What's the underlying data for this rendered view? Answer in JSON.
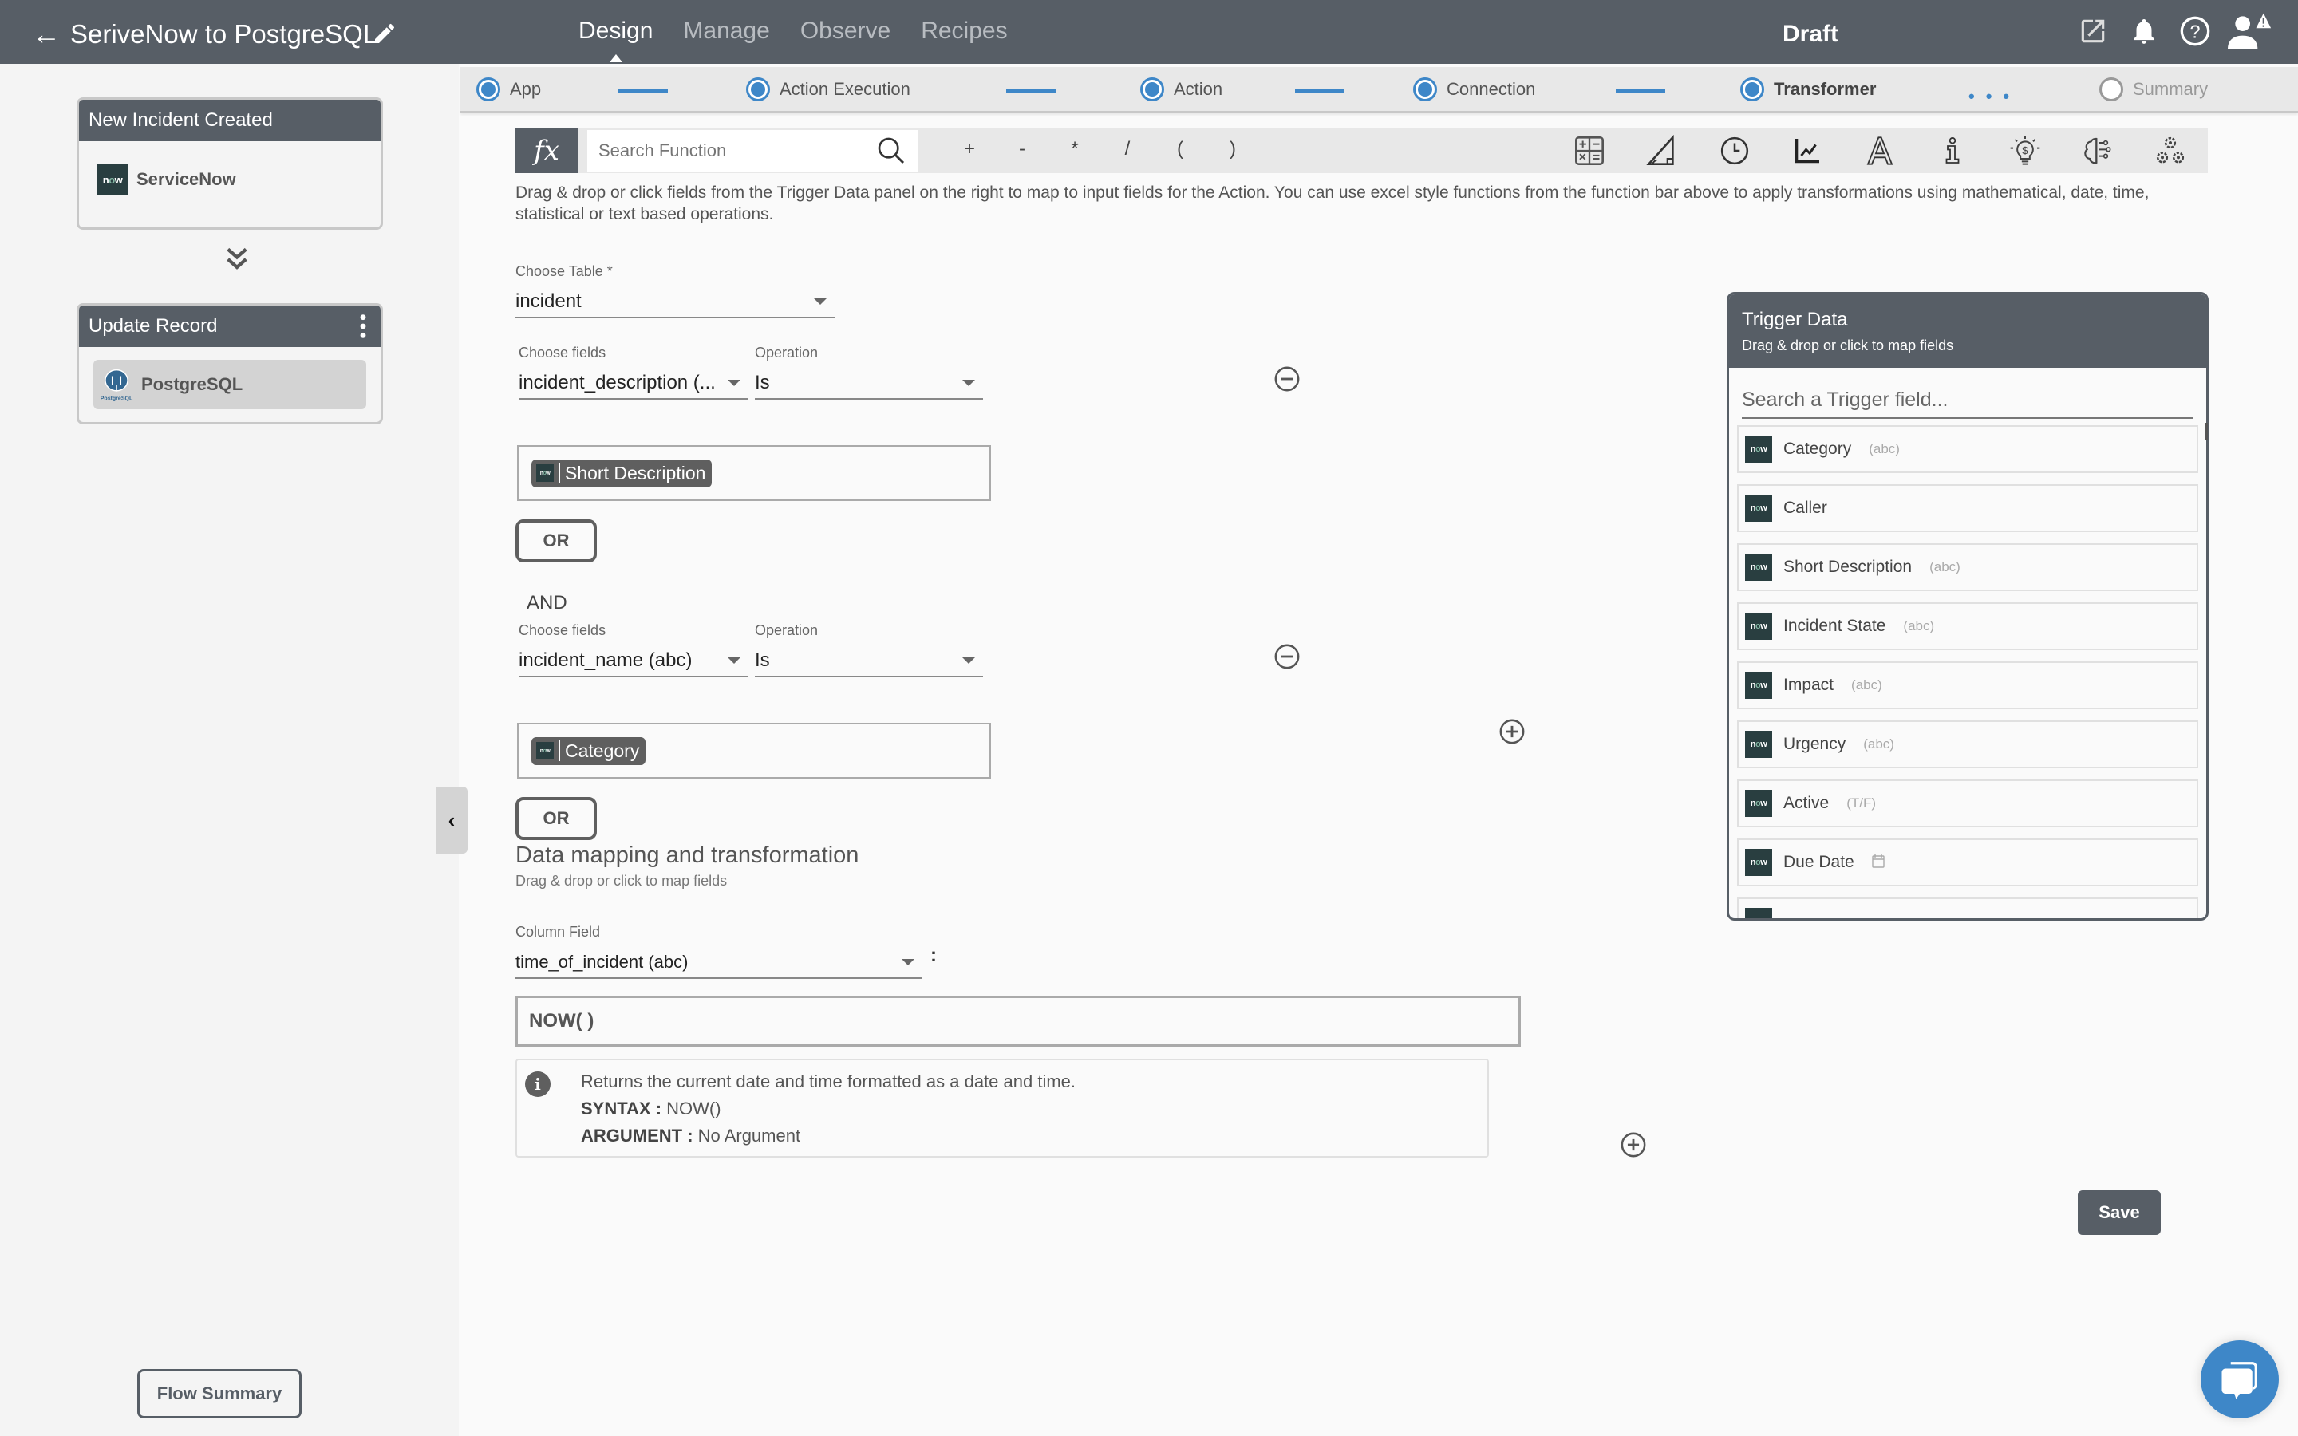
{
  "topbar": {
    "back_icon": "arrow-left-icon",
    "title": "SeriveNow to PostgreSQL",
    "edit_icon": "pencil-icon",
    "tabs": [
      {
        "label": "Design",
        "active": true
      },
      {
        "label": "Manage",
        "active": false
      },
      {
        "label": "Observe",
        "active": false
      },
      {
        "label": "Recipes",
        "active": false
      }
    ],
    "status": "Draft",
    "icons": [
      "external-link-icon",
      "bell-icon",
      "help-icon",
      "user-alert-icon"
    ]
  },
  "leftpanel": {
    "trigger_card": {
      "title": "New Incident Created",
      "app": "ServiceNow",
      "logo_text": "now"
    },
    "connector_icon": "chevron-double-down-icon",
    "action_card": {
      "title": "Update Record",
      "app": "PostgreSQL",
      "menu_icon": "kebab-menu-icon"
    },
    "flow_summary_label": "Flow Summary",
    "collapse_icon": "chevron-left-icon"
  },
  "stepper": {
    "steps": [
      {
        "label": "App",
        "state": "done"
      },
      {
        "label": "Action Execution",
        "state": "done"
      },
      {
        "label": "Action",
        "state": "done"
      },
      {
        "label": "Connection",
        "state": "done"
      },
      {
        "label": "Transformer",
        "state": "current"
      },
      {
        "label": "Summary",
        "state": "pending"
      }
    ]
  },
  "function_bar": {
    "fx_label": "fx",
    "search_placeholder": "Search Function",
    "operators": [
      "+",
      "-",
      "*",
      "/",
      "(",
      ")"
    ],
    "categories": [
      "math-icon",
      "trigonometry-icon",
      "clock-icon",
      "statistics-chart-icon",
      "text-icon",
      "info-icon",
      "finance-bulb-icon",
      "ai-brain-icon",
      "advanced-gears-icon"
    ]
  },
  "instructions": "Drag & drop or click fields from the Trigger Data panel on the right to map to input fields for the Action. You can use excel style functions from the function bar above to apply transformations using mathematical, date, time, statistical or text based operations.",
  "form": {
    "table": {
      "label": "Choose Table *",
      "value": "incident"
    },
    "conditions": [
      {
        "field_label": "Choose fields",
        "field_value": "incident_description (...",
        "op_label": "Operation",
        "op_value": "Is",
        "chip": "Short Description",
        "or_label": "OR"
      },
      {
        "connector": "AND",
        "field_label": "Choose fields",
        "field_value": "incident_name (abc)",
        "op_label": "Operation",
        "op_value": "Is",
        "chip": "Category",
        "or_label": "OR"
      }
    ],
    "mapping_title": "Data mapping and transformation",
    "mapping_sub": "Drag & drop or click to map fields",
    "column": {
      "label": "Column Field",
      "value": "time_of_incident (abc)",
      "separator": ":"
    },
    "formula": "NOW( )",
    "help": {
      "description": "Returns the current date and time formatted as a date and time.",
      "syntax_label": "SYNTAX :",
      "syntax": "NOW()",
      "argument_label": "ARGUMENT :",
      "argument": "No Argument"
    },
    "save_label": "Save"
  },
  "trigger_data": {
    "title": "Trigger Data",
    "subtitle": "Drag & drop or click to map fields",
    "search_placeholder": "Search a Trigger field...",
    "fields": [
      {
        "name": "Category",
        "type": "(abc)"
      },
      {
        "name": "Caller",
        "type": ""
      },
      {
        "name": "Short Description",
        "type": "(abc)"
      },
      {
        "name": "Incident State",
        "type": "(abc)"
      },
      {
        "name": "Impact",
        "type": "(abc)"
      },
      {
        "name": "Urgency",
        "type": "(abc)"
      },
      {
        "name": "Active",
        "type": "(T/F)"
      },
      {
        "name": "Due Date",
        "type": "calendar-icon"
      }
    ]
  },
  "colors": {
    "header": "#575e66",
    "accent": "#3e87c8",
    "servicenow": "#293e40"
  }
}
